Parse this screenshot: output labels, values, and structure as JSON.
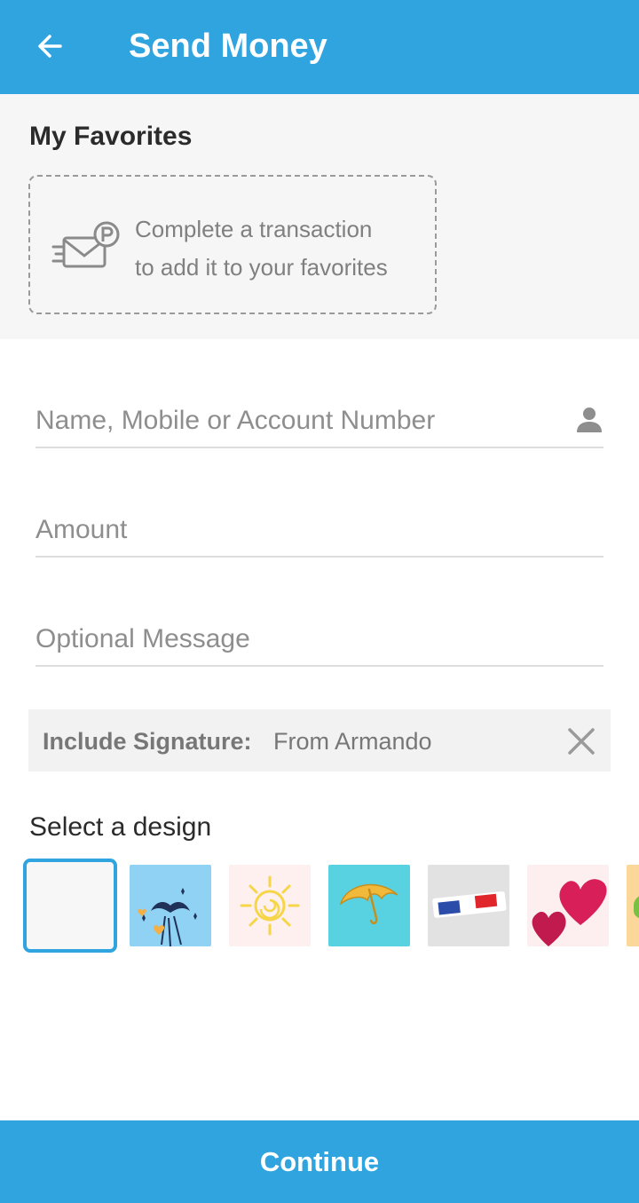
{
  "header": {
    "title": "Send Money",
    "back_icon": "arrow-left-icon",
    "background": "#2fa4df"
  },
  "favorites": {
    "heading": "My Favorites",
    "icon": "envelope-send-icon",
    "empty_line1": "Complete a transaction",
    "empty_line2": "to add it to your favorites"
  },
  "form": {
    "recipient_placeholder": "Name, Mobile or Account Number",
    "recipient_value": "",
    "recipient_icon": "person-icon",
    "amount_placeholder": "Amount",
    "amount_value": "",
    "message_placeholder": "Optional Message",
    "message_value": ""
  },
  "signature": {
    "label": "Include Signature:",
    "value": "From Armando",
    "clear_icon": "close-icon"
  },
  "designs": {
    "heading": "Select a design",
    "items": [
      {
        "name": "blank",
        "selected": true
      },
      {
        "name": "mustache-party",
        "selected": false
      },
      {
        "name": "sun",
        "selected": false
      },
      {
        "name": "umbrella",
        "selected": false
      },
      {
        "name": "3d-glasses",
        "selected": false
      },
      {
        "name": "hearts",
        "selected": false
      },
      {
        "name": "burger",
        "selected": false
      }
    ]
  },
  "footer": {
    "continue_label": "Continue"
  },
  "colors": {
    "accent": "#2fa4df",
    "section_bg": "#f6f6f6"
  }
}
